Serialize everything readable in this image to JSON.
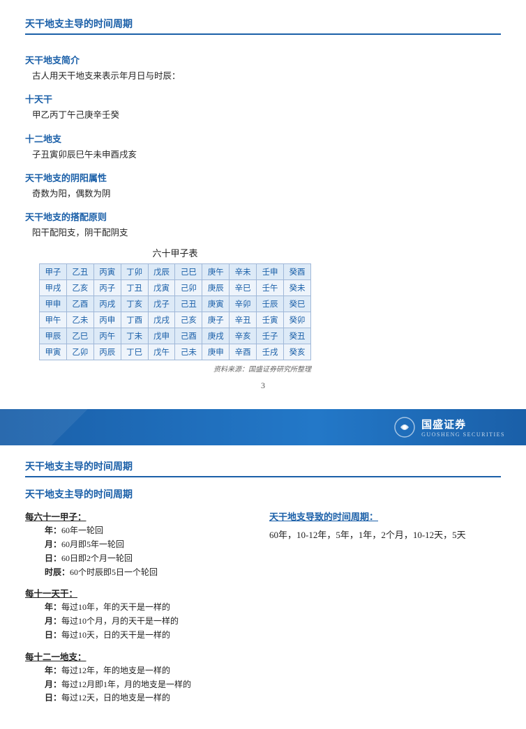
{
  "page1": {
    "main_title": "天干地支主导的时间周期",
    "intro_title": "天干地支简介",
    "intro_body": "古人用天干地支来表示年月日与时辰：",
    "tiangan_title": "十天干",
    "tiangan_body": "甲乙丙丁午己庚辛壬癸",
    "dizhi_title": "十二地支",
    "dizhi_body": "子丑寅卯辰巳午未申酉戌亥",
    "yinyang_title": "天干地支的阴阳属性",
    "yinyang_body": "奇数为阳，偶数为阴",
    "peihe_title": "天干地支的搭配原则",
    "peihe_body": "阳干配阳支，阴干配阴支",
    "table_title": "六十甲子表",
    "table_rows": [
      [
        "甲子",
        "乙丑",
        "丙寅",
        "丁卯",
        "戊辰",
        "己巳",
        "庚午",
        "辛未",
        "壬申",
        "癸酉"
      ],
      [
        "甲戌",
        "乙亥",
        "丙子",
        "丁丑",
        "戊寅",
        "己卯",
        "庚辰",
        "辛巳",
        "壬午",
        "癸未"
      ],
      [
        "甲申",
        "乙酉",
        "丙戌",
        "丁亥",
        "戊子",
        "己丑",
        "庚寅",
        "辛卯",
        "壬辰",
        "癸巳"
      ],
      [
        "甲午",
        "乙未",
        "丙申",
        "丁酉",
        "戊戌",
        "己亥",
        "庚子",
        "辛丑",
        "壬寅",
        "癸卯"
      ],
      [
        "甲辰",
        "乙巳",
        "丙午",
        "丁未",
        "戊申",
        "己酉",
        "庚戌",
        "辛亥",
        "壬子",
        "癸丑"
      ],
      [
        "甲寅",
        "乙卯",
        "丙辰",
        "丁巳",
        "戊午",
        "己未",
        "庚申",
        "辛酉",
        "壬戌",
        "癸亥"
      ]
    ],
    "source_note": "资料来源：国盛证券研究所整理",
    "page_number": "3"
  },
  "divider": {
    "brand_name": "国盛证券",
    "brand_en": "GUOSHENG SECURITIES"
  },
  "page2": {
    "main_title": "天干地支主导的时间周期",
    "section_title": "天干地支主导的时间周期",
    "left_heading": "每六十一甲子：",
    "left_items": [
      {
        "label": "年：",
        "value": "60年一轮回"
      },
      {
        "label": "月：",
        "value": "60月即5年一轮回"
      },
      {
        "label": "日：",
        "value": "60日即2个月一轮回"
      },
      {
        "label": "时辰：",
        "value": "60个时辰即5日一个轮回"
      }
    ],
    "mid_heading": "每十一天干：",
    "mid_items": [
      {
        "label": "年：",
        "value": "每过10年，年的天干是一样的"
      },
      {
        "label": "月：",
        "value": "每过10个月，月的天干是一样的"
      },
      {
        "label": "日：",
        "value": "每过10天，日的天干是一样的"
      }
    ],
    "bot_heading": "每十二一地支：",
    "bot_items": [
      {
        "label": "年：",
        "value": "每过12年，年的地支是一样的"
      },
      {
        "label": "月：",
        "value": "每过12月即1年，月的地支是一样的"
      },
      {
        "label": "日：",
        "value": "每过12天，日的地支是一样的"
      }
    ],
    "right_heading": "天干地支导致的时间周期：",
    "right_value": "60年，10-12年，5年，1年，2个月，10-12天，5天"
  }
}
